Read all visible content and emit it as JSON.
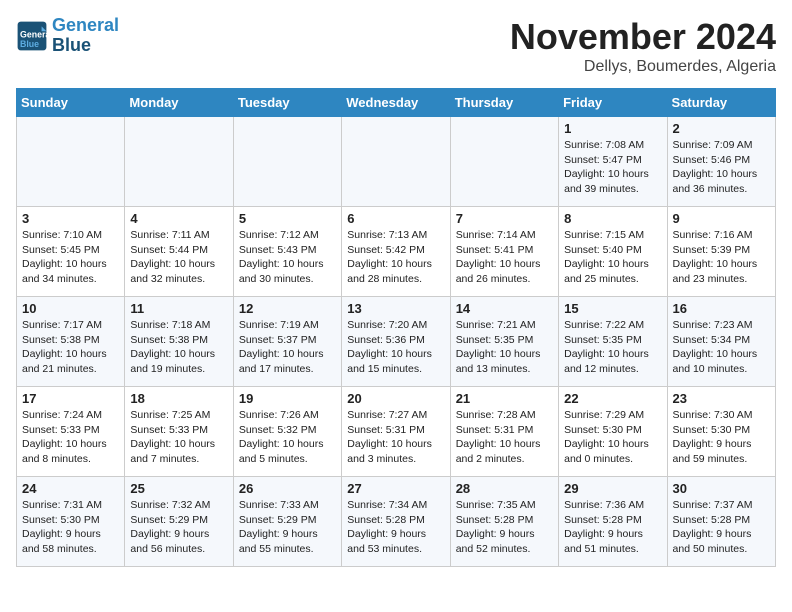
{
  "logo": {
    "line1": "General",
    "line2": "Blue"
  },
  "title": "November 2024",
  "location": "Dellys, Boumerdes, Algeria",
  "weekdays": [
    "Sunday",
    "Monday",
    "Tuesday",
    "Wednesday",
    "Thursday",
    "Friday",
    "Saturday"
  ],
  "weeks": [
    [
      {
        "day": "",
        "info": ""
      },
      {
        "day": "",
        "info": ""
      },
      {
        "day": "",
        "info": ""
      },
      {
        "day": "",
        "info": ""
      },
      {
        "day": "",
        "info": ""
      },
      {
        "day": "1",
        "info": "Sunrise: 7:08 AM\nSunset: 5:47 PM\nDaylight: 10 hours\nand 39 minutes."
      },
      {
        "day": "2",
        "info": "Sunrise: 7:09 AM\nSunset: 5:46 PM\nDaylight: 10 hours\nand 36 minutes."
      }
    ],
    [
      {
        "day": "3",
        "info": "Sunrise: 7:10 AM\nSunset: 5:45 PM\nDaylight: 10 hours\nand 34 minutes."
      },
      {
        "day": "4",
        "info": "Sunrise: 7:11 AM\nSunset: 5:44 PM\nDaylight: 10 hours\nand 32 minutes."
      },
      {
        "day": "5",
        "info": "Sunrise: 7:12 AM\nSunset: 5:43 PM\nDaylight: 10 hours\nand 30 minutes."
      },
      {
        "day": "6",
        "info": "Sunrise: 7:13 AM\nSunset: 5:42 PM\nDaylight: 10 hours\nand 28 minutes."
      },
      {
        "day": "7",
        "info": "Sunrise: 7:14 AM\nSunset: 5:41 PM\nDaylight: 10 hours\nand 26 minutes."
      },
      {
        "day": "8",
        "info": "Sunrise: 7:15 AM\nSunset: 5:40 PM\nDaylight: 10 hours\nand 25 minutes."
      },
      {
        "day": "9",
        "info": "Sunrise: 7:16 AM\nSunset: 5:39 PM\nDaylight: 10 hours\nand 23 minutes."
      }
    ],
    [
      {
        "day": "10",
        "info": "Sunrise: 7:17 AM\nSunset: 5:38 PM\nDaylight: 10 hours\nand 21 minutes."
      },
      {
        "day": "11",
        "info": "Sunrise: 7:18 AM\nSunset: 5:38 PM\nDaylight: 10 hours\nand 19 minutes."
      },
      {
        "day": "12",
        "info": "Sunrise: 7:19 AM\nSunset: 5:37 PM\nDaylight: 10 hours\nand 17 minutes."
      },
      {
        "day": "13",
        "info": "Sunrise: 7:20 AM\nSunset: 5:36 PM\nDaylight: 10 hours\nand 15 minutes."
      },
      {
        "day": "14",
        "info": "Sunrise: 7:21 AM\nSunset: 5:35 PM\nDaylight: 10 hours\nand 13 minutes."
      },
      {
        "day": "15",
        "info": "Sunrise: 7:22 AM\nSunset: 5:35 PM\nDaylight: 10 hours\nand 12 minutes."
      },
      {
        "day": "16",
        "info": "Sunrise: 7:23 AM\nSunset: 5:34 PM\nDaylight: 10 hours\nand 10 minutes."
      }
    ],
    [
      {
        "day": "17",
        "info": "Sunrise: 7:24 AM\nSunset: 5:33 PM\nDaylight: 10 hours\nand 8 minutes."
      },
      {
        "day": "18",
        "info": "Sunrise: 7:25 AM\nSunset: 5:33 PM\nDaylight: 10 hours\nand 7 minutes."
      },
      {
        "day": "19",
        "info": "Sunrise: 7:26 AM\nSunset: 5:32 PM\nDaylight: 10 hours\nand 5 minutes."
      },
      {
        "day": "20",
        "info": "Sunrise: 7:27 AM\nSunset: 5:31 PM\nDaylight: 10 hours\nand 3 minutes."
      },
      {
        "day": "21",
        "info": "Sunrise: 7:28 AM\nSunset: 5:31 PM\nDaylight: 10 hours\nand 2 minutes."
      },
      {
        "day": "22",
        "info": "Sunrise: 7:29 AM\nSunset: 5:30 PM\nDaylight: 10 hours\nand 0 minutes."
      },
      {
        "day": "23",
        "info": "Sunrise: 7:30 AM\nSunset: 5:30 PM\nDaylight: 9 hours\nand 59 minutes."
      }
    ],
    [
      {
        "day": "24",
        "info": "Sunrise: 7:31 AM\nSunset: 5:30 PM\nDaylight: 9 hours\nand 58 minutes."
      },
      {
        "day": "25",
        "info": "Sunrise: 7:32 AM\nSunset: 5:29 PM\nDaylight: 9 hours\nand 56 minutes."
      },
      {
        "day": "26",
        "info": "Sunrise: 7:33 AM\nSunset: 5:29 PM\nDaylight: 9 hours\nand 55 minutes."
      },
      {
        "day": "27",
        "info": "Sunrise: 7:34 AM\nSunset: 5:28 PM\nDaylight: 9 hours\nand 53 minutes."
      },
      {
        "day": "28",
        "info": "Sunrise: 7:35 AM\nSunset: 5:28 PM\nDaylight: 9 hours\nand 52 minutes."
      },
      {
        "day": "29",
        "info": "Sunrise: 7:36 AM\nSunset: 5:28 PM\nDaylight: 9 hours\nand 51 minutes."
      },
      {
        "day": "30",
        "info": "Sunrise: 7:37 AM\nSunset: 5:28 PM\nDaylight: 9 hours\nand 50 minutes."
      }
    ]
  ]
}
